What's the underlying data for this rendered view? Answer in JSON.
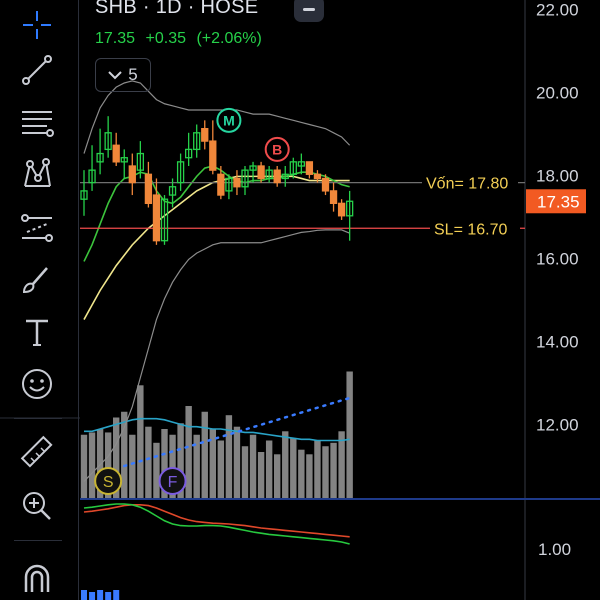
{
  "header": {
    "symbol_line": "SHB · 1D · HOSE",
    "last_price": "17.35",
    "change": "+0.35",
    "change_pct": "(+2.06%)",
    "indicators_count": "5"
  },
  "colors": {
    "up": "#26d14a",
    "down": "#f0873a",
    "ma_fast": "#3cc43c",
    "ma_slow": "#f0e68c",
    "bollinger": "#8c8c8c",
    "volume": "#8a8a8a",
    "volume_ma": "#29a3c7",
    "volume_trend": "#3a7bff",
    "stop_loss": "#f04c4c",
    "entry_line": "#6f6f6f",
    "last_price_tag": "#f25a22",
    "osc_green": "#27c93f",
    "osc_red": "#e0482a"
  },
  "toolbar": {
    "tools": [
      {
        "name": "crosshair-icon"
      },
      {
        "name": "trend-line-icon"
      },
      {
        "name": "fib-lines-icon"
      },
      {
        "name": "pattern-icon"
      },
      {
        "name": "forecast-icon"
      },
      {
        "name": "brush-icon"
      },
      {
        "name": "text-icon"
      },
      {
        "name": "emoji-icon"
      },
      {
        "name": "ruler-icon"
      },
      {
        "name": "zoom-in-icon"
      },
      {
        "name": "magnet-icon"
      }
    ]
  },
  "chart_data": {
    "type": "candlestick",
    "price_axis": {
      "ticks": [
        "22.00",
        "20.00",
        "18.00",
        "16.00",
        "14.00",
        "12.00"
      ],
      "ylim": [
        10.2,
        22.2
      ]
    },
    "osc_axis": {
      "ticks": [
        "1.00"
      ]
    },
    "lines": {
      "entry": {
        "label": "Vốn= 17.80",
        "value": 17.8
      },
      "stop_loss": {
        "label": "SL= 16.70",
        "value": 16.7
      },
      "last": {
        "label": "17.35",
        "value": 17.35
      }
    },
    "markers": [
      {
        "label": "M",
        "color": "#26d6a0",
        "x_index": 18,
        "price": 19.3
      },
      {
        "label": "B",
        "color": "#f04c4c",
        "x_index": 24,
        "price": 18.6
      }
    ],
    "volume_markers": [
      {
        "label": "S",
        "color": "#c8b432",
        "x_index": 3
      },
      {
        "label": "F",
        "color": "#7b5ce0",
        "x_index": 11
      }
    ],
    "candles": [
      [
        17.4,
        18.1,
        17.0,
        17.6
      ],
      [
        17.8,
        18.7,
        17.6,
        18.1
      ],
      [
        18.3,
        19.1,
        18.0,
        18.5
      ],
      [
        18.6,
        19.4,
        18.4,
        19.0
      ],
      [
        18.7,
        19.0,
        18.2,
        18.3
      ],
      [
        18.3,
        18.6,
        17.9,
        18.4
      ],
      [
        18.2,
        18.5,
        17.5,
        17.8
      ],
      [
        18.1,
        18.8,
        17.9,
        18.5
      ],
      [
        18.0,
        18.3,
        17.2,
        17.3
      ],
      [
        17.5,
        17.9,
        16.3,
        16.4
      ],
      [
        16.4,
        17.5,
        16.3,
        17.4
      ],
      [
        17.5,
        17.9,
        17.2,
        17.7
      ],
      [
        17.8,
        18.5,
        17.6,
        18.3
      ],
      [
        18.4,
        19.0,
        18.2,
        18.6
      ],
      [
        18.6,
        19.2,
        18.4,
        19.0
      ],
      [
        19.1,
        19.3,
        18.6,
        18.8
      ],
      [
        18.8,
        19.3,
        18.0,
        18.1
      ],
      [
        18.0,
        18.2,
        17.4,
        17.5
      ],
      [
        17.6,
        18.0,
        17.4,
        17.9
      ],
      [
        17.9,
        18.1,
        17.5,
        17.7
      ],
      [
        17.7,
        18.2,
        17.5,
        18.1
      ],
      [
        18.1,
        18.3,
        17.8,
        18.2
      ],
      [
        18.2,
        18.3,
        17.8,
        17.9
      ],
      [
        17.9,
        18.2,
        17.8,
        18.1
      ],
      [
        18.1,
        18.2,
        17.7,
        17.8
      ],
      [
        17.9,
        18.2,
        17.7,
        18.0
      ],
      [
        18.0,
        18.4,
        17.9,
        18.3
      ],
      [
        18.2,
        18.5,
        18.0,
        18.3
      ],
      [
        18.3,
        18.3,
        17.9,
        18.0
      ],
      [
        18.0,
        18.1,
        17.8,
        17.9
      ],
      [
        17.9,
        18.0,
        17.5,
        17.6
      ],
      [
        17.6,
        17.8,
        17.1,
        17.3
      ],
      [
        17.3,
        17.4,
        16.9,
        17.0
      ],
      [
        17.0,
        17.6,
        16.4,
        17.35
      ]
    ],
    "volume": [
      0.55,
      0.57,
      0.6,
      0.57,
      0.7,
      0.75,
      0.55,
      0.98,
      0.62,
      0.48,
      0.6,
      0.55,
      0.65,
      0.8,
      0.55,
      0.75,
      0.6,
      0.5,
      0.72,
      0.62,
      0.45,
      0.55,
      0.4,
      0.5,
      0.38,
      0.58,
      0.52,
      0.42,
      0.38,
      0.5,
      0.45,
      0.48,
      0.58,
      1.1
    ],
    "ma_fast": [
      15.9,
      16.3,
      16.8,
      17.3,
      17.7,
      17.9,
      17.95,
      18.05,
      18.0,
      17.6,
      17.35,
      17.3,
      17.45,
      17.7,
      17.95,
      18.15,
      18.2,
      18.1,
      17.95,
      17.85,
      17.8,
      17.85,
      17.85,
      17.9,
      17.9,
      17.95,
      18.0,
      18.05,
      18.05,
      18.0,
      17.95,
      17.85,
      17.75,
      17.7
    ],
    "ma_slow": [
      14.5,
      14.85,
      15.2,
      15.5,
      15.8,
      16.05,
      16.3,
      16.5,
      16.7,
      16.85,
      17.0,
      17.15,
      17.3,
      17.45,
      17.6,
      17.7,
      17.8,
      17.85,
      17.9,
      17.95,
      17.95,
      17.95,
      17.95,
      17.95,
      17.95,
      17.95,
      17.95,
      17.9,
      17.85,
      17.85,
      17.85,
      17.85,
      17.85,
      17.85
    ],
    "bb_upper": [
      18.5,
      19.1,
      19.6,
      19.9,
      20.1,
      20.2,
      20.25,
      20.2,
      20.0,
      19.8,
      19.7,
      19.65,
      19.6,
      19.55,
      19.55,
      19.55,
      19.55,
      19.55,
      19.55,
      19.55,
      19.5,
      19.45,
      19.45,
      19.45,
      19.4,
      19.35,
      19.3,
      19.25,
      19.2,
      19.15,
      19.1,
      19.0,
      18.9,
      18.7
    ],
    "bb_lower": [
      10.6,
      10.8,
      11.0,
      11.2,
      11.5,
      11.9,
      12.4,
      13.1,
      13.8,
      14.5,
      15.0,
      15.4,
      15.7,
      15.95,
      16.1,
      16.2,
      16.3,
      16.35,
      16.35,
      16.35,
      16.35,
      16.35,
      16.35,
      16.4,
      16.45,
      16.5,
      16.55,
      16.6,
      16.62,
      16.65,
      16.66,
      16.66,
      16.66,
      16.58
    ],
    "vol_ma": [
      0.58,
      0.58,
      0.6,
      0.62,
      0.64,
      0.66,
      0.68,
      0.69,
      0.69,
      0.69,
      0.68,
      0.66,
      0.64,
      0.62,
      0.62,
      0.61,
      0.6,
      0.6,
      0.59,
      0.58,
      0.57,
      0.57,
      0.56,
      0.55,
      0.54,
      0.53,
      0.52,
      0.51,
      0.51,
      0.5,
      0.5,
      0.5,
      0.5,
      0.51
    ],
    "osc_green": [
      0.8,
      0.82,
      0.85,
      0.88,
      0.9,
      0.9,
      0.88,
      0.82,
      0.72,
      0.6,
      0.48,
      0.4,
      0.36,
      0.35,
      0.35,
      0.36,
      0.36,
      0.35,
      0.32,
      0.28,
      0.24,
      0.2,
      0.17,
      0.14,
      0.12,
      0.1,
      0.08,
      0.06,
      0.04,
      0.02,
      0.0,
      -0.02,
      -0.05,
      -0.1
    ],
    "osc_red": [
      0.7,
      0.72,
      0.75,
      0.78,
      0.82,
      0.86,
      0.88,
      0.88,
      0.86,
      0.8,
      0.72,
      0.64,
      0.56,
      0.5,
      0.46,
      0.44,
      0.42,
      0.41,
      0.4,
      0.38,
      0.36,
      0.33,
      0.3,
      0.28,
      0.26,
      0.24,
      0.22,
      0.2,
      0.18,
      0.16,
      0.14,
      0.12,
      0.1,
      0.08
    ]
  }
}
